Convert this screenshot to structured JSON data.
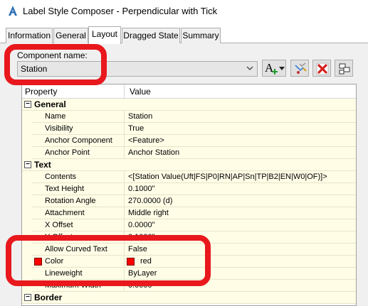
{
  "window": {
    "title": "Label Style Composer - Perpendicular with Tick"
  },
  "tabs": [
    {
      "label": "Information"
    },
    {
      "label": "General"
    },
    {
      "label": "Layout"
    },
    {
      "label": "Dragged State"
    },
    {
      "label": "Summary"
    }
  ],
  "active_tab": "Layout",
  "component": {
    "label": "Component name:",
    "value": "Station"
  },
  "toolbar": {
    "create_text_icon_label": "A"
  },
  "grid": {
    "header_property": "Property",
    "header_value": "Value",
    "categories": [
      {
        "label": "General",
        "rows": [
          {
            "name": "Name",
            "value": "Station"
          },
          {
            "name": "Visibility",
            "value": "True"
          },
          {
            "name": "Anchor Component",
            "value": "<Feature>"
          },
          {
            "name": "Anchor Point",
            "value": "Anchor Station"
          }
        ]
      },
      {
        "label": "Text",
        "rows": [
          {
            "name": "Contents",
            "value": "<[Station Value(Uft|FS|P0|RN|AP|Sn|TP|B2|EN|W0|OF)]>"
          },
          {
            "name": "Text Height",
            "value": "0.1000\""
          },
          {
            "name": "Rotation Angle",
            "value": "270.0000 (d)"
          },
          {
            "name": "Attachment",
            "value": "Middle right"
          },
          {
            "name": "X Offset",
            "value": "0.0000\""
          },
          {
            "name": "Y Offset",
            "value": "0.1000\""
          },
          {
            "name": "Allow Curved Text",
            "value": "False"
          },
          {
            "name": "Color",
            "value": "red",
            "swatch_color": "#ff0000"
          },
          {
            "name": "Lineweight",
            "value": "ByLayer"
          },
          {
            "name": "Maximum Width",
            "value": "0.0000\""
          }
        ]
      },
      {
        "label": "Border",
        "rows": []
      }
    ]
  },
  "colors": {
    "highlight_red": "#e8181d",
    "row_background": "#fffde6",
    "panel_background": "#f0f0f0"
  }
}
